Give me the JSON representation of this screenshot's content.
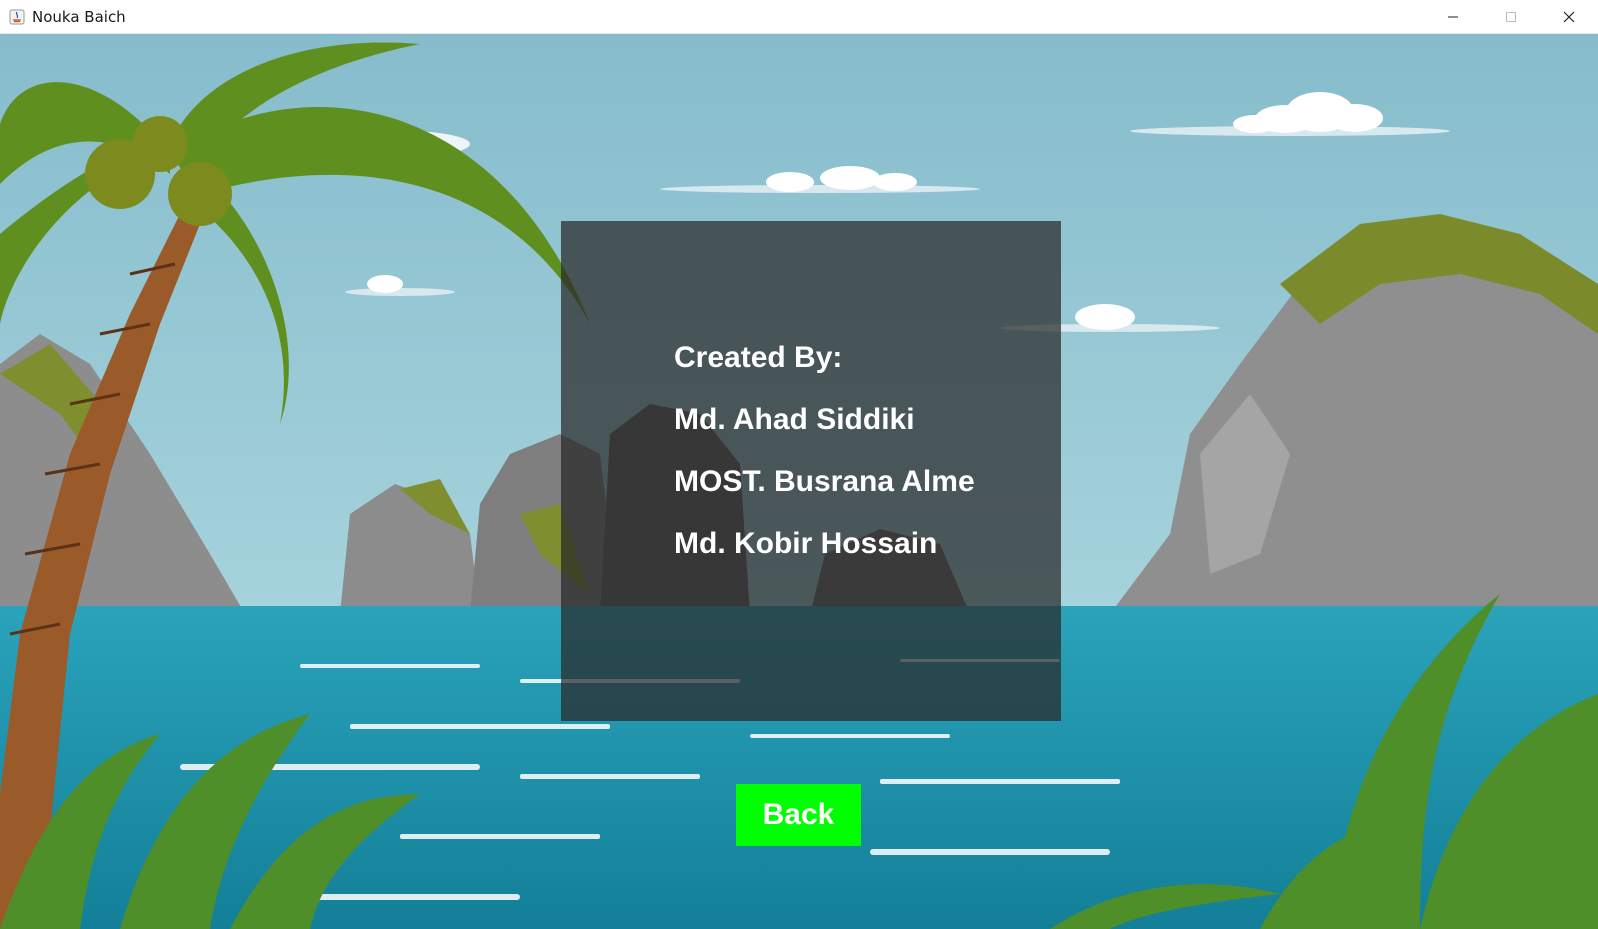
{
  "window": {
    "title": "Nouka Baich",
    "controls": [
      "minimize-icon",
      "maximize-icon",
      "close-icon"
    ]
  },
  "credits": {
    "heading": "Created By:",
    "authors": [
      "Md. Ahad Siddiki",
      "MOST. Busrana Alme",
      "Md. Kobir Hossain"
    ]
  },
  "back_button": {
    "label": "Back",
    "color": "#00ff00"
  },
  "background": {
    "description_icon": "tropical-beach-background",
    "sky_color": "#8fbfcf",
    "sea_color": "#1f9bb3",
    "panel_color": "#282828"
  }
}
